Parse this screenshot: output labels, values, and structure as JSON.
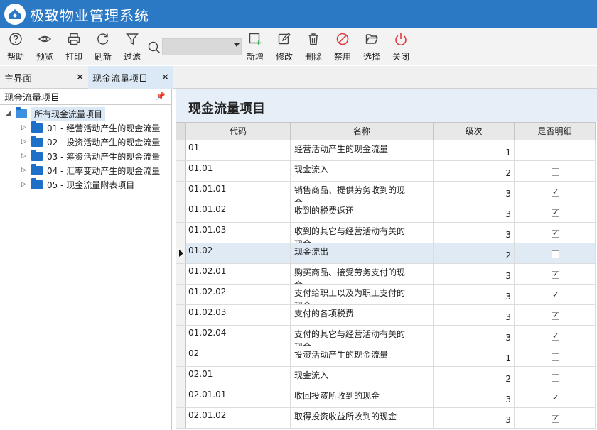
{
  "app": {
    "title": "极致物业管理系统"
  },
  "toolbar": {
    "help": "帮助",
    "preview": "预览",
    "print": "打印",
    "refresh": "刷新",
    "filter": "过滤",
    "add": "新增",
    "edit": "修改",
    "delete": "删除",
    "disable": "禁用",
    "select": "选择",
    "close": "关闭",
    "search_value": ""
  },
  "tabs": [
    {
      "label": "主界面"
    },
    {
      "label": "现金流量项目"
    }
  ],
  "left": {
    "header": "现金流量项目",
    "root": "所有现金流量项目",
    "items": [
      "01 - 经营活动产生的现金流量",
      "02 - 投资活动产生的现金流量",
      "03 - 筹资活动产生的现金流量",
      "04 - 汇率变动产生的现金流量",
      "05 - 现金流量附表项目"
    ]
  },
  "main": {
    "title": "现金流量项目",
    "columns": [
      "代码",
      "名称",
      "级次",
      "是否明细"
    ],
    "rows": [
      {
        "code": "01",
        "name": "经营活动产生的现金流量",
        "level": "1",
        "detail": false
      },
      {
        "code": "01.01",
        "name": "现金流入",
        "level": "2",
        "detail": false
      },
      {
        "code": "01.01.01",
        "name": "销售商品、提供劳务收到的现\n金",
        "level": "3",
        "detail": true
      },
      {
        "code": "01.01.02",
        "name": "收到的税费返还",
        "level": "3",
        "detail": true
      },
      {
        "code": "01.01.03",
        "name": "收到的其它与经营活动有关的\n现金",
        "level": "3",
        "detail": true
      },
      {
        "code": "01.02",
        "name": "现金流出",
        "level": "2",
        "detail": false,
        "selected": true
      },
      {
        "code": "01.02.01",
        "name": "购买商品、接受劳务支付的现\n金",
        "level": "3",
        "detail": true
      },
      {
        "code": "01.02.02",
        "name": "支付给职工以及为职工支付的\n现金",
        "level": "3",
        "detail": true
      },
      {
        "code": "01.02.03",
        "name": "支付的各项税费",
        "level": "3",
        "detail": true
      },
      {
        "code": "01.02.04",
        "name": "支付的其它与经营活动有关的\n现金",
        "level": "3",
        "detail": true
      },
      {
        "code": "02",
        "name": "投资活动产生的现金流量",
        "level": "1",
        "detail": false
      },
      {
        "code": "02.01",
        "name": "现金流入",
        "level": "2",
        "detail": false
      },
      {
        "code": "02.01.01",
        "name": "收回投资所收到的现金",
        "level": "3",
        "detail": true
      },
      {
        "code": "02.01.02",
        "name": "取得投资收益所收到的现金",
        "level": "3",
        "detail": true
      }
    ]
  }
}
